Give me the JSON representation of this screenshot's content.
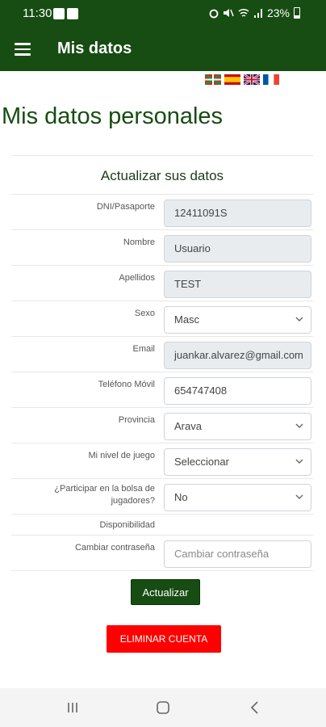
{
  "status_bar": {
    "time": "11:30",
    "battery": "23%"
  },
  "app_bar": {
    "title": "Mis datos"
  },
  "page": {
    "heading": "Mis datos personales"
  },
  "form": {
    "title": "Actualizar sus datos",
    "dni": {
      "label": "DNI/Pasaporte",
      "value": "12411091S"
    },
    "nombre": {
      "label": "Nombre",
      "value": "Usuario"
    },
    "apellidos": {
      "label": "Apellidos",
      "value": "TEST"
    },
    "sexo": {
      "label": "Sexo",
      "value": "Masc"
    },
    "email": {
      "label": "Email",
      "value": "juankar.alvarez@gmail.com"
    },
    "telefono": {
      "label": "Teléfono Móvil",
      "value": "654747408"
    },
    "provincia": {
      "label": "Provincia",
      "value": "Arava"
    },
    "nivel": {
      "label": "Mi nivel de juego",
      "value": "Seleccionar"
    },
    "bolsa": {
      "label": "¿Participar en la bolsa de jugadores?",
      "value": "No"
    },
    "disponibilidad": {
      "label": "Disponibilidad"
    },
    "contrasena": {
      "label": "Cambiar contraseña",
      "placeholder": "Cambiar contraseña"
    }
  },
  "buttons": {
    "update": "Actualizar",
    "delete": "ELIMINAR CUENTA"
  },
  "colors": {
    "primary": "#174d12",
    "danger": "#ff0000"
  }
}
